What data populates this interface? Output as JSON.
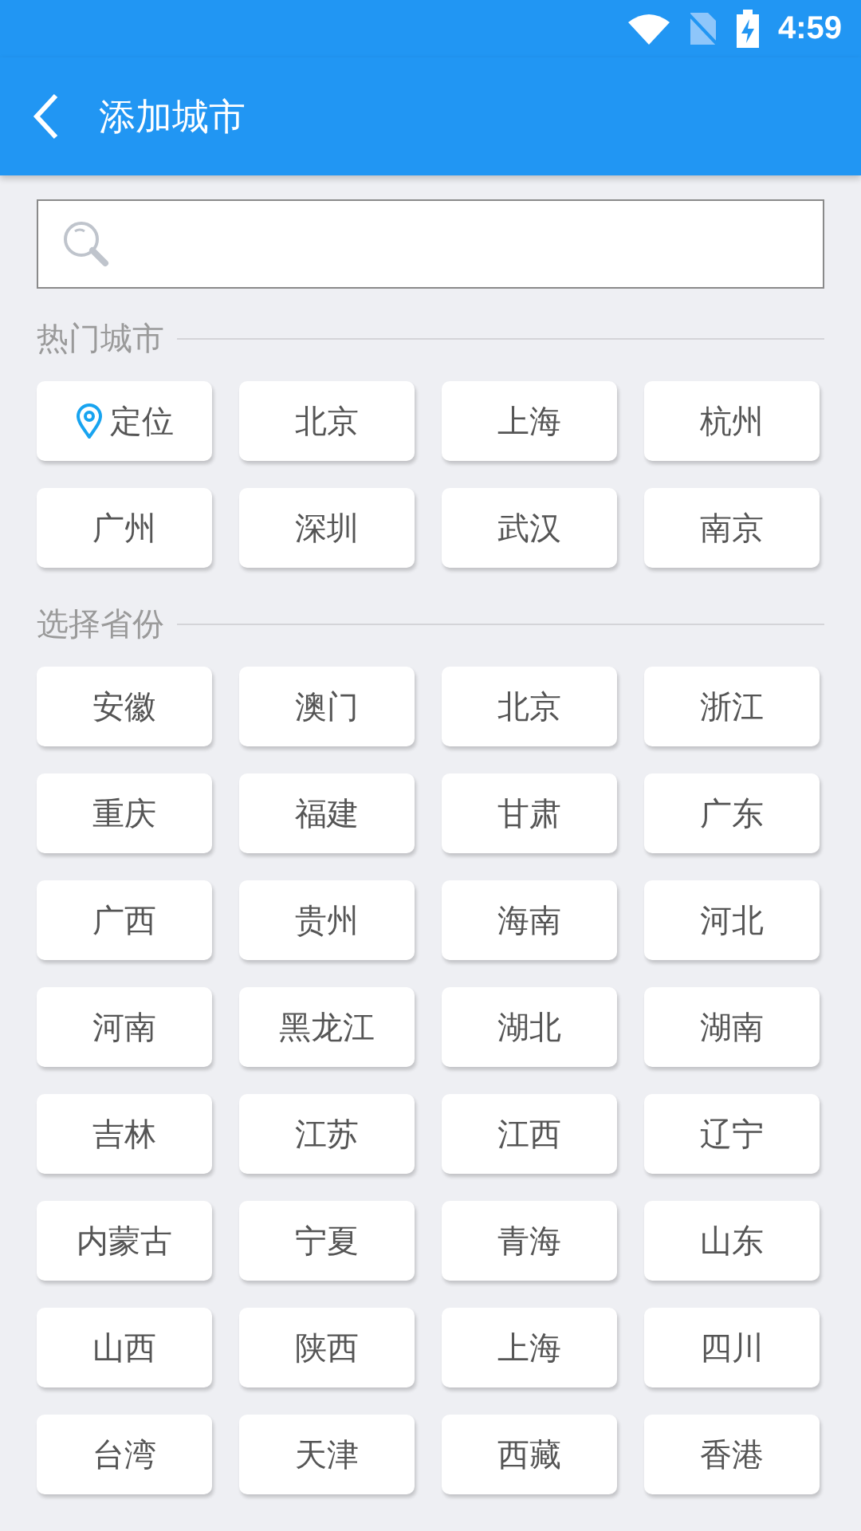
{
  "status_bar": {
    "time": "4:59"
  },
  "toolbar": {
    "title": "添加城市"
  },
  "hot_section": {
    "title": "热门城市",
    "items": [
      {
        "kind": "locate",
        "label": "定位"
      },
      {
        "kind": "city",
        "label": "北京"
      },
      {
        "kind": "city",
        "label": "上海"
      },
      {
        "kind": "city",
        "label": "杭州"
      },
      {
        "kind": "city",
        "label": "广州"
      },
      {
        "kind": "city",
        "label": "深圳"
      },
      {
        "kind": "city",
        "label": "武汉"
      },
      {
        "kind": "city",
        "label": "南京"
      }
    ]
  },
  "province_section": {
    "title": "选择省份",
    "items": [
      "安徽",
      "澳门",
      "北京",
      "浙江",
      "重庆",
      "福建",
      "甘肃",
      "广东",
      "广西",
      "贵州",
      "海南",
      "河北",
      "河南",
      "黑龙江",
      "湖北",
      "湖南",
      "吉林",
      "江苏",
      "江西",
      "辽宁",
      "内蒙古",
      "宁夏",
      "青海",
      "山东",
      "山西",
      "陕西",
      "上海",
      "四川",
      "台湾",
      "天津",
      "西藏",
      "香港"
    ]
  }
}
